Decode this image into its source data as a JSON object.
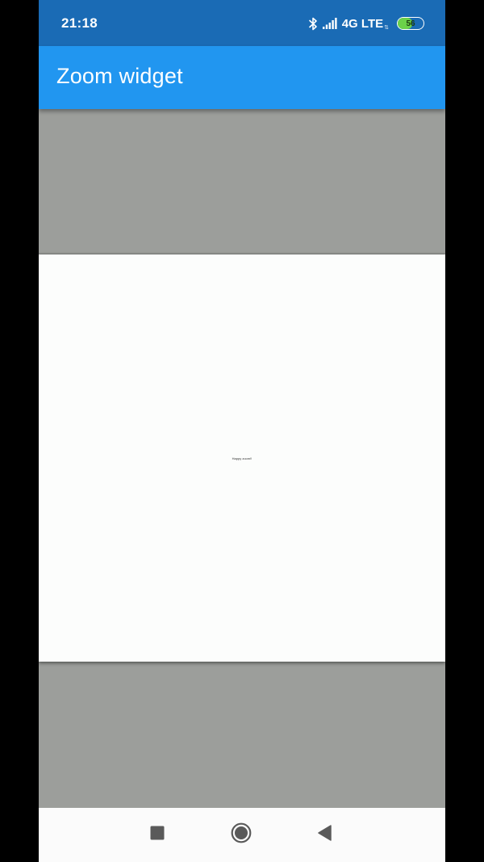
{
  "status_bar": {
    "time": "21:18",
    "network": "4G LTE",
    "network_sub": "⇅",
    "battery_level": "56",
    "battery_fraction": 0.56,
    "icons": [
      "bluetooth-icon",
      "signal-icon",
      "battery-icon"
    ]
  },
  "app_bar": {
    "title": "Zoom widget"
  },
  "zoom": {
    "canvas_text": "Happy zoom!!"
  },
  "nav_bar": {
    "buttons": [
      "recents-icon",
      "home-icon",
      "back-icon"
    ]
  },
  "colors": {
    "status_bar": "#1a6bb5",
    "app_bar": "#2196f0",
    "background": "#9c9e9b",
    "canvas": "#fcfdfc",
    "battery_fill": "#6bd14a",
    "nav_bar": "#fbfbfb",
    "nav_icons": "#5a5a5a"
  }
}
